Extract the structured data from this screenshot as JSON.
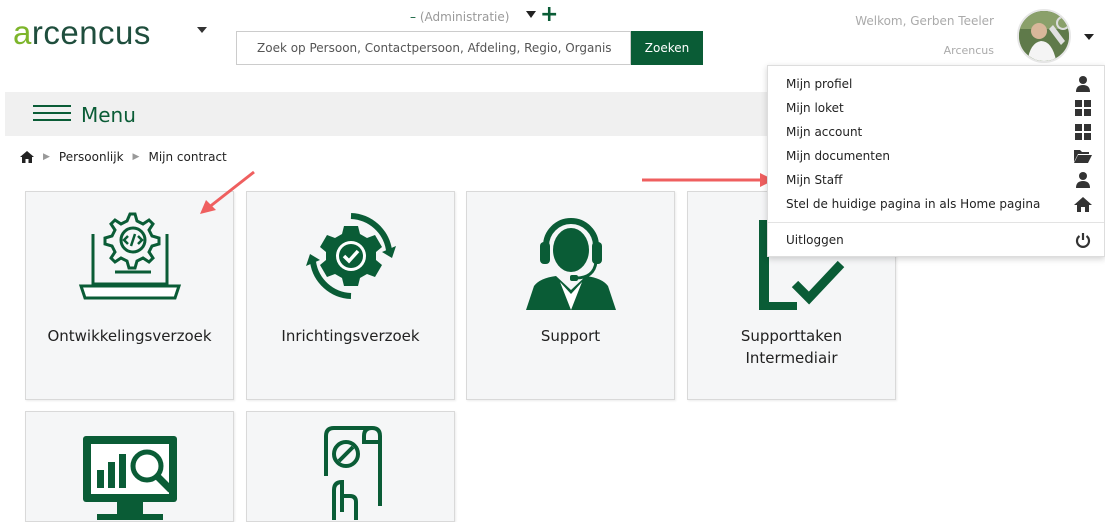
{
  "header": {
    "logo_a": "a",
    "logo_rest": "rcencus",
    "admin_label": "(Administratie)",
    "admin_dash": "–",
    "search_placeholder": "Zoek op Persoon, Contactpersoon, Afdeling, Regio, Organis",
    "search_button": "Zoeken",
    "welcome": "Welkom, Gerben Teeler",
    "company": "Arcencus"
  },
  "menu": {
    "label": "Menu"
  },
  "breadcrumb": [
    "Persoonlijk",
    "Mijn contract"
  ],
  "tiles": [
    {
      "line1": "Ontwikkelingsverzoek",
      "line2": "",
      "icon": "laptop-gear-code-icon"
    },
    {
      "line1": "Inrichtingsverzoek",
      "line2": "",
      "icon": "gear-refresh-check-icon"
    },
    {
      "line1": "Support",
      "line2": "",
      "icon": "headset-agent-icon"
    },
    {
      "line1": "Supporttaken",
      "line2": "Intermediair",
      "icon": "clipboard-check-icon"
    },
    {
      "line1": "",
      "line2": "",
      "icon": "monitor-analytics-icon"
    },
    {
      "line1": "",
      "line2": "",
      "icon": "hand-document-icon"
    }
  ],
  "dropdown": {
    "items": [
      {
        "label": "Mijn profiel",
        "icon": "user-icon"
      },
      {
        "label": "Mijn loket",
        "icon": "grid-icon"
      },
      {
        "label": "Mijn account",
        "icon": "grid-icon"
      },
      {
        "label": "Mijn documenten",
        "icon": "folder-open-icon"
      },
      {
        "label": "Mijn Staff",
        "icon": "user-icon"
      },
      {
        "label": "Stel de huidige pagina in als Home pagina",
        "icon": "home-icon"
      }
    ],
    "logout": {
      "label": "Uitloggen",
      "icon": "power-icon"
    }
  },
  "colors": {
    "brand_green": "#0a5c36",
    "logo_accent": "#7db52b",
    "annotation_arrow": "#ef5f5f"
  }
}
